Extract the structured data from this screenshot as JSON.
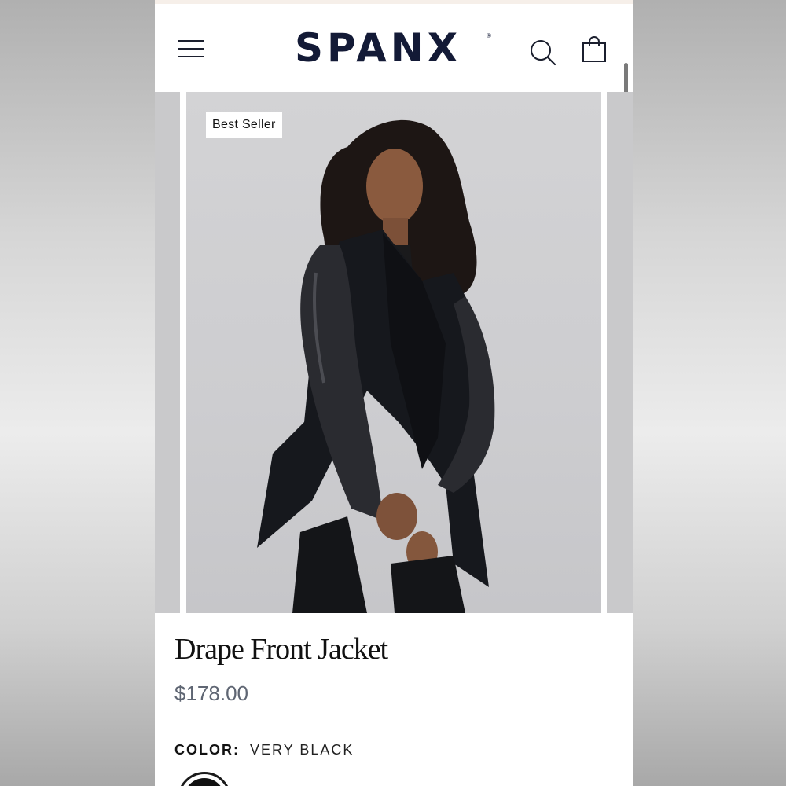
{
  "brand": {
    "logo_text": "SPANX",
    "registered_mark": "®"
  },
  "header": {
    "menu_icon": "hamburger-menu-icon",
    "search_icon": "search-icon",
    "bag_icon": "shopping-bag-icon"
  },
  "gallery": {
    "badge": "Best Seller",
    "image_subject": "model-wearing-jacket"
  },
  "product": {
    "title": "Drape Front Jacket",
    "price": "$178.00",
    "color_label": "COLOR:",
    "color_value": "VERY BLACK",
    "swatch_color": "#111111"
  },
  "colors": {
    "brand_navy": "#131a36",
    "price_gray": "#5f6673",
    "image_background": "#cfcfd1"
  }
}
